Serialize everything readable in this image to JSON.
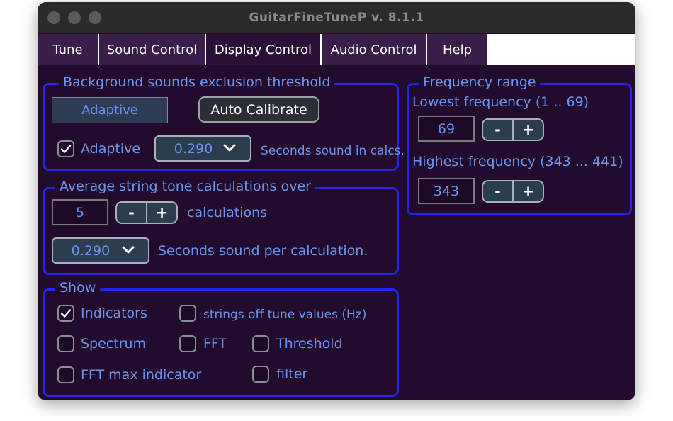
{
  "window": {
    "title": "GuitarFineTuneP v. 8.1.1"
  },
  "tabs": [
    {
      "label": "Tune",
      "active": false
    },
    {
      "label": "Sound Control",
      "active": false
    },
    {
      "label": "Display Control",
      "active": true
    },
    {
      "label": "Audio Control",
      "active": false
    },
    {
      "label": "Help",
      "active": false
    }
  ],
  "background_threshold": {
    "legend": "Background sounds exclusion threshold",
    "mode_button": "Adaptive",
    "calibrate_button": "Auto Calibrate",
    "adaptive_checkbox": {
      "label": "Adaptive",
      "checked": true
    },
    "seconds_dropdown": "0.290",
    "seconds_label": "Seconds sound in calcs."
  },
  "average_calc": {
    "legend": "Average string tone calculations over",
    "count_value": "5",
    "count_label": "calculations",
    "seconds_dropdown": "0.290",
    "seconds_label": "Seconds sound per calculation."
  },
  "show": {
    "legend": "Show",
    "indicators": {
      "label": "Indicators",
      "checked": true
    },
    "strings_off": {
      "label": "strings off tune values (Hz)",
      "checked": false
    },
    "spectrum": {
      "label": "Spectrum",
      "checked": false
    },
    "fft": {
      "label": "FFT",
      "checked": false
    },
    "threshold": {
      "label": "Threshold",
      "checked": false
    },
    "fft_max": {
      "label": "FFT max indicator",
      "checked": false
    },
    "filter": {
      "label": "filter",
      "checked": false
    }
  },
  "frequency_range": {
    "legend": "Frequency range",
    "lowest_label": "Lowest frequency (1 .. 69)",
    "lowest_value": "69",
    "highest_label": "Highest frequency (343 ... 441)",
    "highest_value": "343"
  },
  "stepper": {
    "minus": "-",
    "plus": "+"
  },
  "colors": {
    "window_bg": "#220b2c",
    "accent_text": "#6c94ee",
    "panel_border": "#2326e6",
    "tab_bg": "#3b1d49"
  },
  "icons": [
    "checkmark-icon",
    "chevron-down-icon"
  ]
}
